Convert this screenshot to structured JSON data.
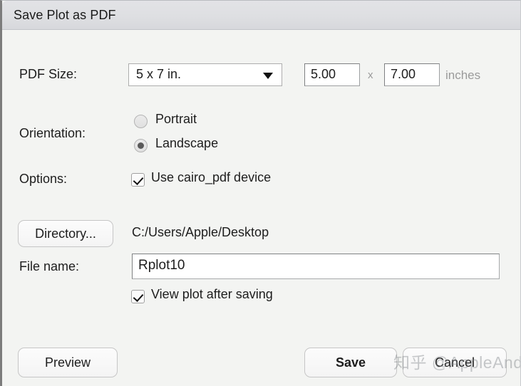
{
  "window": {
    "title": "Save Plot as PDF"
  },
  "pdf_size": {
    "label": "PDF Size:",
    "preset_value": "5 x 7 in.",
    "dropdown_arrow": "chevron-down-icon",
    "width_value": "5.00",
    "separator": "x",
    "height_value": "7.00",
    "units_label": "inches"
  },
  "orientation": {
    "label": "Orientation:",
    "options": [
      {
        "label": "Portrait",
        "selected": false
      },
      {
        "label": "Landscape",
        "selected": true
      }
    ]
  },
  "options": {
    "label": "Options:",
    "cairo": {
      "label": "Use cairo_pdf device",
      "checked": true
    }
  },
  "directory": {
    "button_label": "Directory...",
    "path": "C:/Users/Apple/Desktop"
  },
  "file": {
    "label": "File name:",
    "value": "Rplot10"
  },
  "view_after": {
    "label": "View plot after saving",
    "checked": true
  },
  "buttons": {
    "preview": "Preview",
    "save": "Save",
    "cancel": "Cancel"
  },
  "watermark": {
    "text": "知乎 @AppleAndy"
  },
  "colors": {
    "titlebar": "#dedfe2",
    "body": "#f3f4f2",
    "text": "#1d1d1d",
    "muted_text": "#9a9a9a",
    "field_border": "#a0a0a0"
  }
}
